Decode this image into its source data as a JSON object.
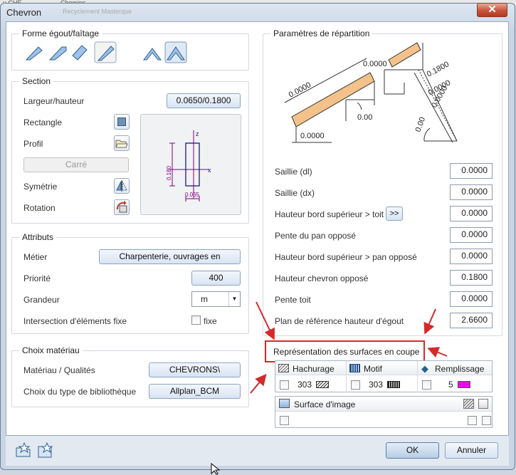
{
  "background": {
    "tab1": "u CHE",
    "tab2": "Chemins",
    "tab3": "Recyclement Masterque"
  },
  "window": {
    "title": "Chevron",
    "close_glyph": "✕"
  },
  "forme": {
    "title": "Forme égout/faîtage"
  },
  "section": {
    "title": "Section",
    "largeur_label": "Largeur/hauteur",
    "largeur_value": "0.0650/0.1800",
    "rectangle_label": "Rectangle",
    "profil_label": "Profil",
    "carre_label": "Carré",
    "symetrie_label": "Symétrie",
    "rotation_label": "Rotation",
    "preview": {
      "z": "z",
      "x": "x",
      "h": "0.180",
      "w": "0.065"
    }
  },
  "attributs": {
    "title": "Attributs",
    "metier_label": "Métier",
    "metier_value": "Charpenterie, ouvrages en",
    "priorite_label": "Priorité",
    "priorite_value": "400",
    "grandeur_label": "Grandeur",
    "grandeur_value": "m",
    "intersection_label": "Intersection d'éléments fixe",
    "fixe_label": "fixe"
  },
  "materiau": {
    "title": "Choix matériau",
    "qualites_label": "Matériau / Qualités",
    "qualites_value": "CHEVRONS\\",
    "biblio_label": "Choix du type de bibliothèque",
    "biblio_value": "Allplan_BCM"
  },
  "params": {
    "title": "Paramètres de répartition",
    "diagram": {
      "a": "0.0000",
      "b": "0.0000",
      "c": "0.0000",
      "d": "0.00",
      "e": "0.0000",
      "f": "0.1800",
      "g": "0.0000",
      "h": "0.00"
    },
    "rows": [
      {
        "label": "Saillie (dl)",
        "value": "0.0000"
      },
      {
        "label": "Saillie (dx)",
        "value": "0.0000"
      },
      {
        "label": "Hauteur bord supérieur > toit",
        "value": "0.0000"
      },
      {
        "label": "Pente du pan opposé",
        "value": "0.0000"
      },
      {
        "label": "Hauteur bord supérieur > pan opposé",
        "value": "0.0000"
      },
      {
        "label": "Hauteur chevron opposé",
        "value": "0.1800"
      },
      {
        "label": "Pente toit",
        "value": "0.0000"
      },
      {
        "label": "Plan de référence hauteur d'égout",
        "value": "2.6600"
      }
    ],
    "more_label": ">>"
  },
  "surfaces": {
    "title": "Représentation des surfaces en coupe",
    "hachurage_label": "Hachurage",
    "hachurage_value": "303",
    "motif_label": "Motif",
    "motif_value": "303",
    "remplissage_label": "Remplissage",
    "remplissage_value": "5",
    "surface_image_label": "Surface d'image",
    "fill_color": "#ee00ee"
  },
  "footer": {
    "ok": "OK",
    "cancel": "Annuler"
  },
  "colors": {
    "accent_red": "#d42a2a",
    "rafter_fill": "#f3c28a"
  }
}
